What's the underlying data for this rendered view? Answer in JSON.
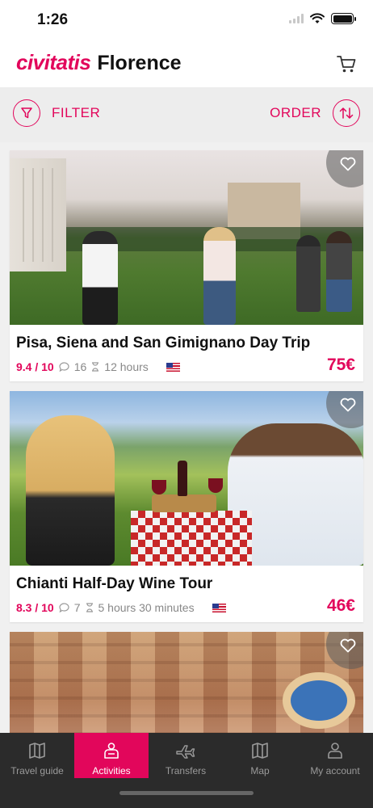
{
  "status_bar": {
    "time": "1:26"
  },
  "header": {
    "brand": "civitatis",
    "city": "Florence",
    "cart_icon": "cart-icon"
  },
  "filter_bar": {
    "filter_label": "FILTER",
    "order_label": "ORDER"
  },
  "activities": [
    {
      "title": "Pisa, Siena and San Gimignano Day Trip",
      "rating": "9.4 / 10",
      "reviews": "16",
      "duration": "12 hours",
      "language": "US English",
      "price": "75€"
    },
    {
      "title": "Chianti Half-Day Wine Tour",
      "rating": "8.3 / 10",
      "reviews": "7",
      "duration": "5 hours 30 minutes",
      "language": "US English",
      "price": "46€"
    },
    {
      "title": "",
      "rating": "",
      "reviews": "",
      "duration": "",
      "language": "",
      "price": ""
    }
  ],
  "tab_bar": {
    "tabs": [
      {
        "label": "Travel guide",
        "icon": "map-book-icon",
        "active": false
      },
      {
        "label": "Activities",
        "icon": "person-icon",
        "active": true
      },
      {
        "label": "Transfers",
        "icon": "plane-icon",
        "active": false
      },
      {
        "label": "Map",
        "icon": "map-icon",
        "active": false
      },
      {
        "label": "My account",
        "icon": "user-icon",
        "active": false
      }
    ]
  },
  "colors": {
    "accent": "#e2065b",
    "tab_bar_bg": "#2b2b2b"
  }
}
